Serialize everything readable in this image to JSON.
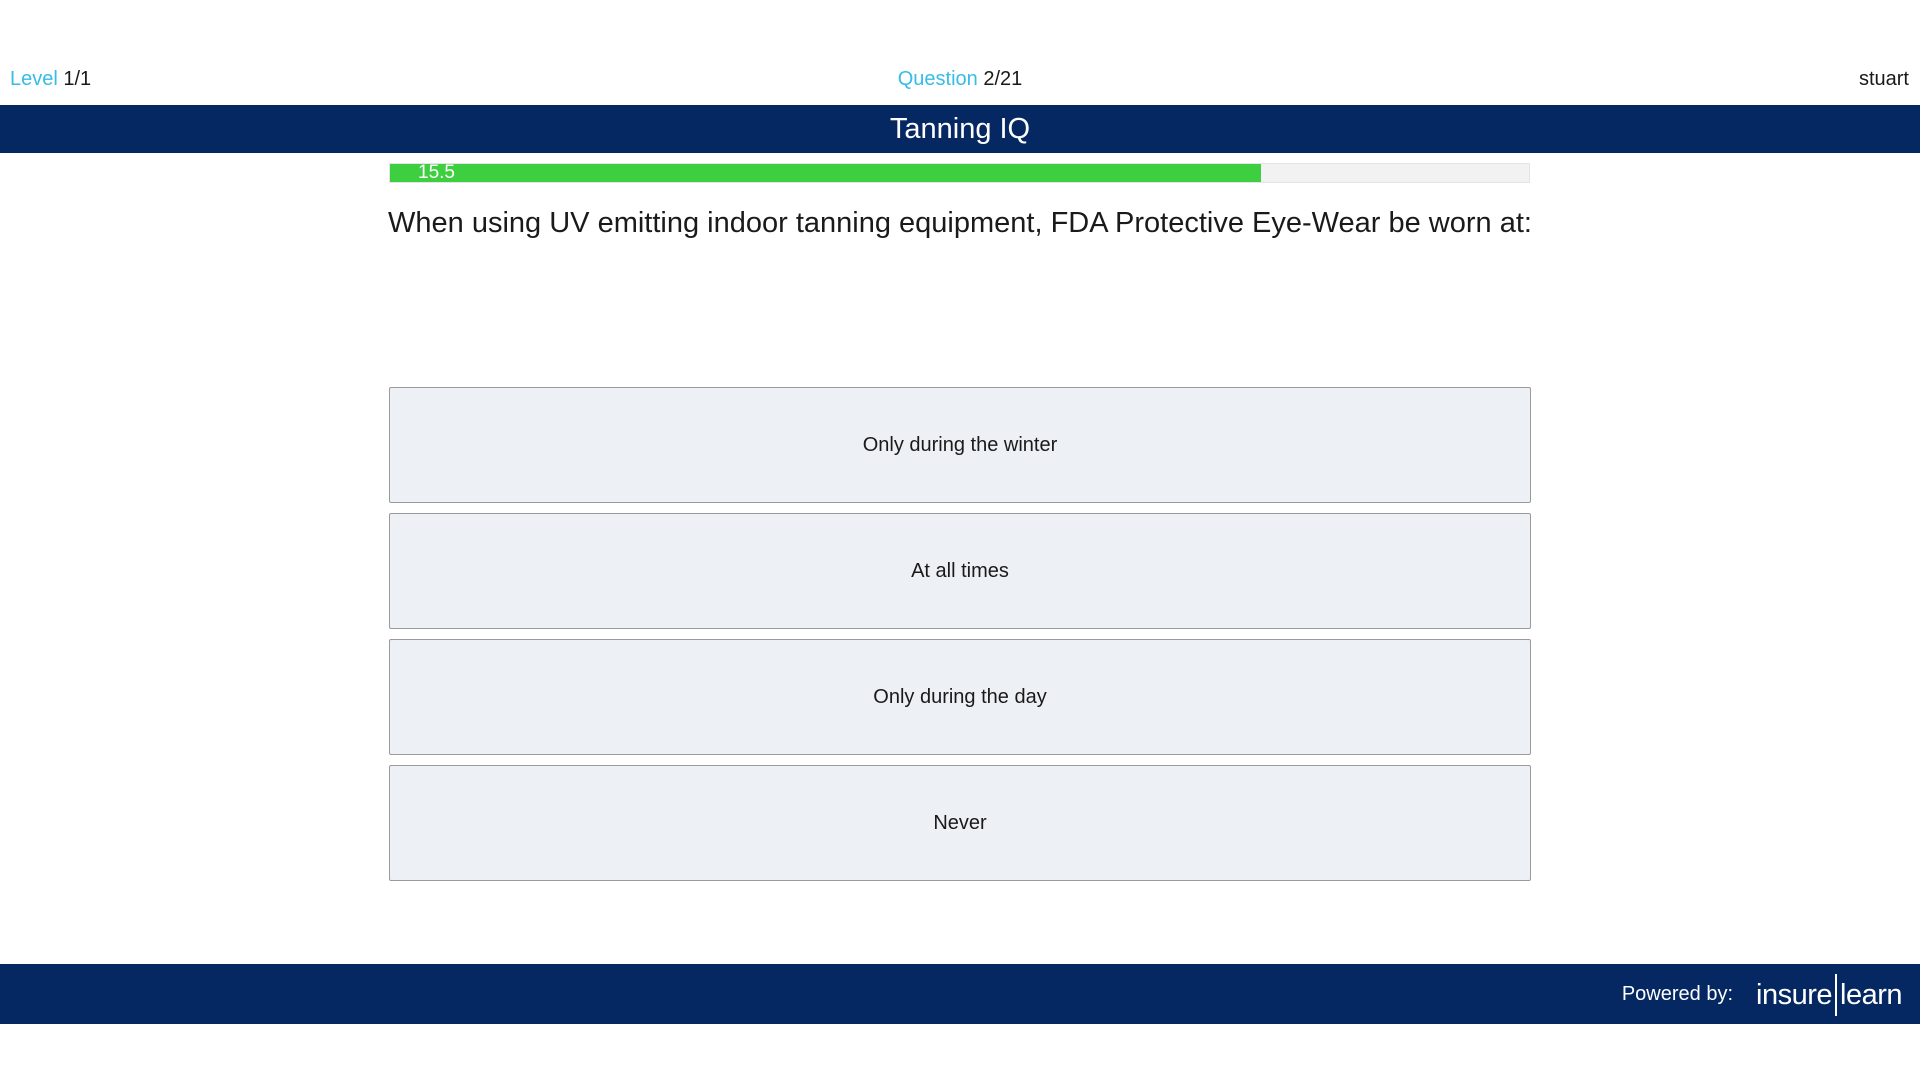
{
  "top_bar": {
    "level_label": "Level",
    "level_value": "1/1",
    "question_label": "Question",
    "question_value": "2/21",
    "username": "stuart"
  },
  "header": {
    "title": "Tanning IQ"
  },
  "progress": {
    "label": "15.5",
    "fill_fraction": 0.765,
    "fill_color": "#3ecf41"
  },
  "question": {
    "text": "When using UV emitting indoor tanning equipment, FDA Protective Eye-Wear be worn at:"
  },
  "answers": [
    {
      "label": "Only during the winter"
    },
    {
      "label": "At all times"
    },
    {
      "label": "Only during the day"
    },
    {
      "label": "Never"
    }
  ],
  "footer": {
    "powered_by": "Powered by:",
    "brand_left": "insure",
    "brand_right": "learn"
  },
  "colors": {
    "brand_navy": "#052862",
    "accent_cyan": "#36bde6",
    "answer_background": "#edf0f5"
  }
}
